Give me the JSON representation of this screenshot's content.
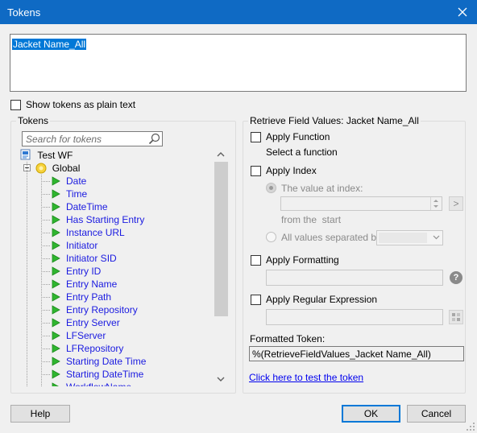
{
  "window": {
    "title": "Tokens"
  },
  "token_editor": {
    "value": "Jacket Name_All"
  },
  "show_plain_text": {
    "label": "Show tokens as plain text",
    "checked": false
  },
  "tokens_panel": {
    "label": "Tokens",
    "search_placeholder": "Search for tokens",
    "root": "Test WF",
    "group": "Global",
    "items": [
      "Date",
      "Time",
      "DateTime",
      "Has Starting Entry",
      "Instance URL",
      "Initiator",
      "Initiator SID",
      "Entry ID",
      "Entry Name",
      "Entry Path",
      "Entry Repository",
      "Entry Server",
      "LFServer",
      "LFRepository",
      "Starting Date Time",
      "Starting DateTime",
      "WorkflowName"
    ]
  },
  "retrieve_panel": {
    "label": "Retrieve Field Values: Jacket Name_All",
    "apply_function": {
      "label": "Apply Function",
      "sub": "Select a function"
    },
    "apply_index": {
      "label": "Apply Index",
      "value_at_index": "The value at index:",
      "from_the_start": "from the  start",
      "all_values_separated": "All values separated by:",
      "go_button": ">"
    },
    "apply_formatting": {
      "label": "Apply Formatting",
      "help": "?"
    },
    "apply_regex": {
      "label": "Apply Regular Expression"
    },
    "formatted_token": {
      "label": "Formatted Token:",
      "value": "%(RetrieveFieldValues_Jacket Name_All)"
    },
    "test_link": "Click here to test the token"
  },
  "buttons": {
    "help": "Help",
    "ok": "OK",
    "cancel": "Cancel"
  }
}
